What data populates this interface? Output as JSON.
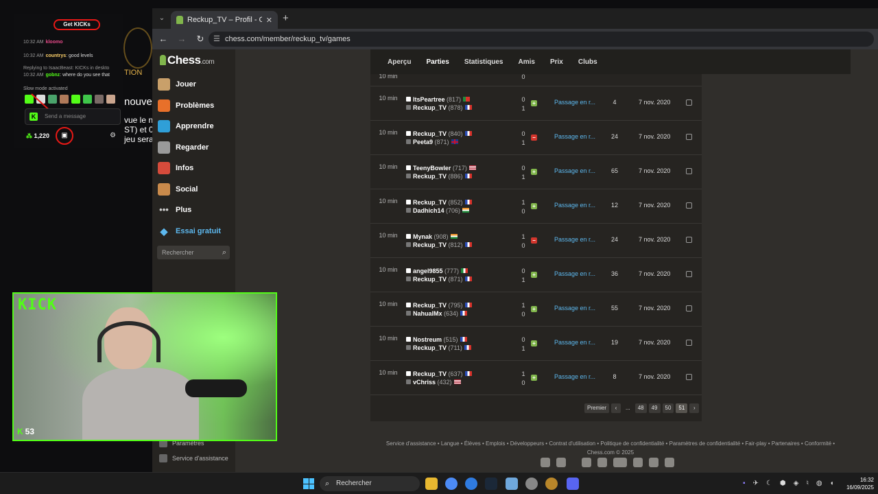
{
  "browser": {
    "tab_title": "Reckup_TV – Profil - Chess.com",
    "tab_close": "✕",
    "new_tab": "+",
    "url": "chess.com/member/reckup_tv/games"
  },
  "chess": {
    "logo_text": "Chess",
    "logo_suffix": ".com",
    "nav": [
      {
        "label": "Jouer",
        "icon": "play-board-icon"
      },
      {
        "label": "Problèmes",
        "icon": "puzzle-icon"
      },
      {
        "label": "Apprendre",
        "icon": "learn-cap-icon"
      },
      {
        "label": "Regarder",
        "icon": "binoculars-icon"
      },
      {
        "label": "Infos",
        "icon": "news-icon"
      },
      {
        "label": "Social",
        "icon": "people-icon"
      },
      {
        "label": "Plus",
        "icon": "more-dots-icon"
      },
      {
        "label": "Essai gratuit",
        "icon": "diamond-icon"
      }
    ],
    "search_placeholder": "Rechercher",
    "sidebar_footer": [
      "Paramètres",
      "Service d'assistance"
    ],
    "profile_tabs": [
      "Aperçu",
      "Parties",
      "Statistiques",
      "Amis",
      "Prix",
      "Clubs"
    ],
    "partial_top_row": {
      "time": "10 min",
      "result": "0"
    },
    "games": [
      {
        "time": "10 min",
        "white": {
          "name": "ItsPeartree",
          "rating": "(817)",
          "flag": "portugal"
        },
        "black": {
          "name": "Reckup_TV",
          "rating": "(878)",
          "flag": "france"
        },
        "score_top": "0",
        "score_bottom": "1",
        "result": "win",
        "accuracy": "Passage en r...",
        "moves": "4",
        "date": "7 nov. 2020"
      },
      {
        "time": "10 min",
        "white": {
          "name": "Reckup_TV",
          "rating": "(840)",
          "flag": "france"
        },
        "black": {
          "name": "Peeta9",
          "rating": "(871)",
          "flag": "uk"
        },
        "score_top": "0",
        "score_bottom": "1",
        "result": "loss",
        "accuracy": "Passage en r...",
        "moves": "24",
        "date": "7 nov. 2020"
      },
      {
        "time": "10 min",
        "white": {
          "name": "TeenyBowler",
          "rating": "(717)",
          "flag": "usa"
        },
        "black": {
          "name": "Reckup_TV",
          "rating": "(886)",
          "flag": "france"
        },
        "score_top": "0",
        "score_bottom": "1",
        "result": "win",
        "accuracy": "Passage en r...",
        "moves": "65",
        "date": "7 nov. 2020"
      },
      {
        "time": "10 min",
        "white": {
          "name": "Reckup_TV",
          "rating": "(852)",
          "flag": "france"
        },
        "black": {
          "name": "Dadhich14",
          "rating": "(706)",
          "flag": "india"
        },
        "score_top": "1",
        "score_bottom": "0",
        "result": "win",
        "accuracy": "Passage en r...",
        "moves": "12",
        "date": "7 nov. 2020"
      },
      {
        "time": "10 min",
        "white": {
          "name": "Mynak",
          "rating": "(908)",
          "flag": "india"
        },
        "black": {
          "name": "Reckup_TV",
          "rating": "(812)",
          "flag": "france"
        },
        "score_top": "1",
        "score_bottom": "0",
        "result": "loss",
        "accuracy": "Passage en r...",
        "moves": "24",
        "date": "7 nov. 2020"
      },
      {
        "time": "10 min",
        "white": {
          "name": "angel9855",
          "rating": "(777)",
          "flag": "mexico"
        },
        "black": {
          "name": "Reckup_TV",
          "rating": "(871)",
          "flag": "france"
        },
        "score_top": "0",
        "score_bottom": "1",
        "result": "win",
        "accuracy": "Passage en r...",
        "moves": "36",
        "date": "7 nov. 2020"
      },
      {
        "time": "10 min",
        "white": {
          "name": "Reckup_TV",
          "rating": "(795)",
          "flag": "france"
        },
        "black": {
          "name": "NahualMx",
          "rating": "(634)",
          "flag": "france"
        },
        "score_top": "1",
        "score_bottom": "0",
        "result": "win",
        "accuracy": "Passage en r...",
        "moves": "55",
        "date": "7 nov. 2020"
      },
      {
        "time": "10 min",
        "white": {
          "name": "Nostreum",
          "rating": "(515)",
          "flag": "france"
        },
        "black": {
          "name": "Reckup_TV",
          "rating": "(711)",
          "flag": "france"
        },
        "score_top": "0",
        "score_bottom": "1",
        "result": "win",
        "accuracy": "Passage en r...",
        "moves": "19",
        "date": "7 nov. 2020"
      },
      {
        "time": "10 min",
        "white": {
          "name": "Reckup_TV",
          "rating": "(637)",
          "flag": "france"
        },
        "black": {
          "name": "vChriss",
          "rating": "(432)",
          "flag": "usa"
        },
        "score_top": "1",
        "score_bottom": "0",
        "result": "win",
        "accuracy": "Passage en r...",
        "moves": "8",
        "date": "7 nov. 2020"
      }
    ],
    "pagination": {
      "first": "Premier",
      "dots": "...",
      "pages": [
        "48",
        "49",
        "50",
        "51"
      ],
      "current": "51"
    },
    "footer_links": "Service d'assistance • Langue • Élèves • Emplois • Développeurs • Contrat d'utilisation • Politique de confidentialité • Paramètres de confidentialité • Fair-play • Partenaires • Conformité •",
    "copyright": "Chess.com © 2025",
    "social_icons": [
      "apple-icon",
      "android-icon",
      "tiktok-icon",
      "x-icon",
      "youtube-icon",
      "twitch-icon",
      "instagram-icon",
      "discord-icon"
    ]
  },
  "stream": {
    "get_kicks": "Get KICKs",
    "messages": [
      {
        "time": "10:32 AM",
        "user": "kloomo",
        "text": ""
      },
      {
        "time": "10:32 AM",
        "user": "countrys",
        "text": ": good levels"
      },
      {
        "time": "",
        "user": "",
        "text": "Replying to IsaacBeast: KICKs in deskto"
      },
      {
        "time": "10:32 AM",
        "user": "gobnz",
        "text": ": where do you see that"
      }
    ],
    "slow_mode": "Slow mode activated",
    "chat_placeholder": "Send a message",
    "points": "1,220",
    "viewers": "53",
    "kick_logo": "KICK",
    "bg_text": [
      "nouve",
      "vue le n",
      "ST) et 0",
      "jeu sera"
    ],
    "bg_title": "TION"
  },
  "taskbar": {
    "search_label": "Rechercher",
    "time": "16:32",
    "date": "16/09/2025"
  }
}
